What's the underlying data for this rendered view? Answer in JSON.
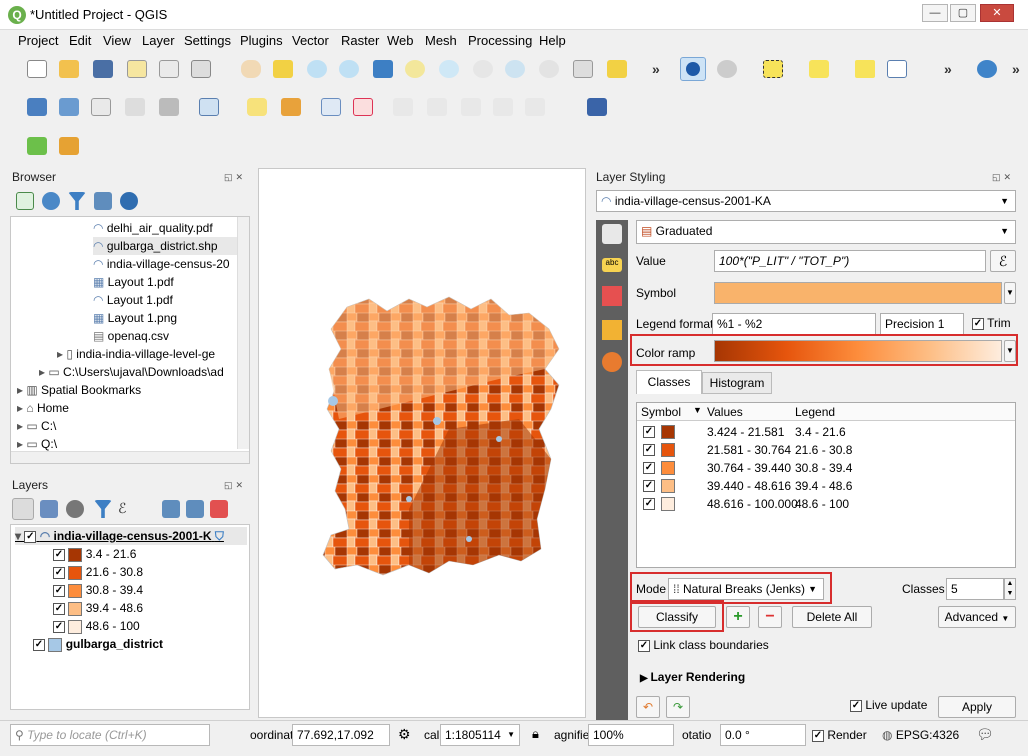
{
  "window": {
    "title": "*Untitled Project - QGIS",
    "minimize": "—",
    "maximize": "▢",
    "close": "✕"
  },
  "menu": [
    "Project",
    "Edit",
    "View",
    "Layer",
    "Settings",
    "Plugins",
    "Vector",
    "Raster",
    "Web",
    "Mesh",
    "Processing",
    "Help"
  ],
  "browser": {
    "title": "Browser",
    "items": [
      {
        "label": "delhi_air_quality.pdf"
      },
      {
        "label": "gulbarga_district.shp"
      },
      {
        "label": "india-village-census-20"
      },
      {
        "label": "Layout 1.pdf"
      },
      {
        "label": "Layout 1.pdf"
      },
      {
        "label": "Layout 1.png"
      },
      {
        "label": "openaq.csv"
      },
      {
        "label": "india-india-village-level-ge"
      },
      {
        "label": "C:\\Users\\ujaval\\Downloads\\ad"
      },
      {
        "label": "Spatial Bookmarks"
      },
      {
        "label": "Home"
      },
      {
        "label": "C:\\"
      },
      {
        "label": "Q:\\"
      }
    ]
  },
  "layers": {
    "title": "Layers",
    "main_layer": "india-village-census-2001-K",
    "classes": [
      {
        "label": "3.4 - 21.6",
        "color": "#a63603"
      },
      {
        "label": "21.6 - 30.8",
        "color": "#e6550d"
      },
      {
        "label": "30.8 - 39.4",
        "color": "#fd8d3c"
      },
      {
        "label": "39.4 - 48.6",
        "color": "#fdbe85"
      },
      {
        "label": "48.6 - 100",
        "color": "#feedde"
      }
    ],
    "district_layer": "gulbarga_district",
    "district_color": "#a6c8e6"
  },
  "styling": {
    "title": "Layer Styling",
    "layer_select": "india-village-census-2001-KA",
    "renderer": "Graduated",
    "value_label": "Value",
    "value_expr": "100*(\"P_LIT\" / \"TOT_P\")",
    "symbol_label": "Symbol",
    "symbol_color": "#f9b36b",
    "legend_format_label": "Legend format",
    "legend_format": "%1 - %2",
    "precision": "Precision 1",
    "trim_label": "Trim",
    "color_ramp_label": "Color ramp",
    "tabs": [
      "Classes",
      "Histogram"
    ],
    "table_headers": [
      "Symbol",
      "Values",
      "Legend"
    ],
    "rows": [
      {
        "color": "#a63603",
        "values": "3.424 - 21.581",
        "legend": "3.4 - 21.6"
      },
      {
        "color": "#e6550d",
        "values": "21.581 - 30.764",
        "legend": "21.6 - 30.8"
      },
      {
        "color": "#fd8d3c",
        "values": "30.764 - 39.440",
        "legend": "30.8 - 39.4"
      },
      {
        "color": "#fdbe85",
        "values": "39.440 - 48.616",
        "legend": "39.4 - 48.6"
      },
      {
        "color": "#feedde",
        "values": "48.616 - 100.000",
        "legend": "48.6 - 100"
      }
    ],
    "mode_label": "Mode",
    "mode_value": "Natural Breaks (Jenks)",
    "classes_label": "Classes",
    "classes_value": "5",
    "classify": "Classify",
    "delete_all": "Delete All",
    "advanced": "Advanced",
    "link_boundaries": "Link class boundaries",
    "layer_rendering": "Layer Rendering",
    "live_update": "Live update",
    "apply": "Apply"
  },
  "status": {
    "locate_placeholder": "Type to locate (Ctrl+K)",
    "coordinate_label": "oordinat",
    "coordinate": "77.692,17.092",
    "scale_label": "cal",
    "scale": "1:1805114",
    "magnifier_label": "agnifie",
    "magnifier": "100%",
    "rotation_label": "otatio",
    "rotation": "0.0 °",
    "render_label": "Render",
    "crs": "EPSG:4326"
  },
  "colors": {
    "accent_red": "#d72d2d",
    "map_bg": "#ffffff"
  }
}
